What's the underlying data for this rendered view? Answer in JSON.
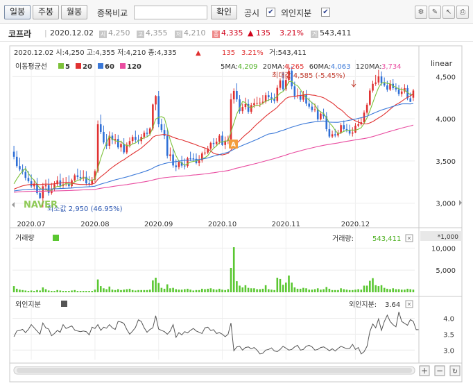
{
  "toolbar": {
    "tabs": [
      {
        "label": "일봉",
        "active": true
      },
      {
        "label": "주봉",
        "active": false
      },
      {
        "label": "월봉",
        "active": false
      }
    ],
    "compare_label": "종목비교",
    "compare_input_value": "",
    "confirm_label": "확인",
    "disclosure_label": "공시",
    "foreign_label": "외인지분",
    "check_mark": "✔",
    "icons": [
      "settings-icon",
      "pencil-icon",
      "cursor-icon",
      "print-icon"
    ]
  },
  "info": {
    "stock_name": "코프라",
    "date": "2020.12.02",
    "open_tag": "시",
    "open": "4,250",
    "high_tag": "고",
    "high": "4,355",
    "low_tag": "저",
    "low": "4,210",
    "close_tag": "종",
    "close": "4,335",
    "change": "▲ 135",
    "change_pct": "3.21%",
    "volume_tag": "거",
    "volume": "543,411"
  },
  "price_panel": {
    "header_text": "2020.12.02  시:4,250  고:4,355  저:4,210  종:4,335",
    "header_arrow": "▲",
    "header_change": "135",
    "header_pct": "3.21%",
    "header_volume": "거:543,411",
    "ma_title": "이동평균선",
    "ma_legend": [
      {
        "label": "5",
        "color": "#7cc139"
      },
      {
        "label": "20",
        "color": "#e03131"
      },
      {
        "label": "60",
        "color": "#3a78d8"
      },
      {
        "label": "120",
        "color": "#e94ca0"
      }
    ],
    "ma_values": [
      {
        "label": "5MA:",
        "value": "4,209",
        "color": "#4caf1f"
      },
      {
        "label": "20MA:",
        "value": "4,265",
        "color": "#e03131"
      },
      {
        "label": "60MA:",
        "value": "4,063",
        "color": "#3a78d8"
      },
      {
        "label": "120MA:",
        "value": "3,734",
        "color": "#e94ca0"
      }
    ],
    "scale_label": "linear",
    "max_label": "최대값 4,585 (-5.45%)",
    "min_label": "최소값 2,950 (46.95%)",
    "logo": "NAVER",
    "disclosure_marker": "A",
    "y_ticks": [
      "4,500",
      "4,000",
      "3,500",
      "3,000"
    ],
    "x_ticks": [
      "2020.07",
      "2020.08",
      "2020.09",
      "2020.10",
      "2020.11",
      "2020.12"
    ]
  },
  "volume_panel": {
    "title": "거래량",
    "current_label": "거래량:",
    "current_value": "543,411",
    "unit": "*1,000",
    "y_ticks": [
      "10,000",
      "5,000"
    ]
  },
  "foreign_panel": {
    "title": "외인지분",
    "current_label": "외인지분:",
    "current_value": "3.64",
    "y_ticks": [
      "4.0",
      "3.5",
      "3.0"
    ]
  },
  "colors": {
    "up": "#e03131",
    "down": "#2f6fd6",
    "volume": "#5ac731",
    "foreign_line": "#555555"
  },
  "chart_data": {
    "type": "candlestick",
    "x_range": [
      "2020-06-22",
      "2020-12-02"
    ],
    "price_ylim": [
      2800,
      4700
    ],
    "candles": {
      "open": [
        3610,
        3550,
        3440,
        3400,
        3370,
        3300,
        3260,
        3200,
        3230,
        3120,
        3060,
        3200,
        3215,
        3120,
        3165,
        3225,
        3270,
        3205,
        3224,
        3234,
        3202,
        3271,
        3330,
        3310,
        3294,
        3312,
        3235,
        3230,
        3279,
        3380,
        3935,
        3845,
        3720,
        3680,
        3800,
        3747,
        3761,
        3661,
        3702,
        3602,
        3692,
        3736,
        3785,
        3749,
        3735,
        3785,
        3835,
        3822,
        3885,
        4170,
        4270,
        3935,
        3868,
        3797,
        3560,
        3577,
        3447,
        3427,
        3489,
        3445,
        3440,
        3533,
        3531,
        3526,
        3475,
        3507,
        3590,
        3600,
        3647,
        3714,
        3702,
        3729,
        3800,
        3690,
        3740,
        3756,
        4230,
        4330,
        4230,
        4090,
        4140,
        4175,
        4084,
        4162,
        4186,
        4186,
        4191,
        4202,
        4279,
        4255,
        4233,
        4211,
        4367,
        4455,
        4350,
        4460,
        4570,
        4385,
        4270,
        4277,
        4226,
        4291,
        4180,
        4144,
        4103,
        4112,
        3993,
        4062,
        4030,
        3877,
        3790,
        3817,
        3802,
        3834,
        3925,
        3878,
        3868,
        3825,
        3837,
        3918,
        3935,
        3959,
        4073,
        4167,
        4334,
        4414,
        4430,
        4502,
        4422,
        4395,
        4346,
        4415,
        4364,
        4348,
        4294,
        4323,
        4363,
        4243,
        4250
      ],
      "high": [
        3680,
        3620,
        3540,
        3460,
        3440,
        3380,
        3340,
        3280,
        3300,
        3190,
        3240,
        3280,
        3290,
        3240,
        3260,
        3320,
        3350,
        3300,
        3310,
        3330,
        3290,
        3350,
        3410,
        3390,
        3390,
        3380,
        3320,
        3310,
        3400,
        3980,
        4050,
        3920,
        3820,
        3850,
        3840,
        3820,
        3810,
        3740,
        3770,
        3720,
        3780,
        3810,
        3860,
        3810,
        3820,
        3860,
        3890,
        3900,
        4180,
        4280,
        4330,
        4000,
        3940,
        3870,
        3660,
        3650,
        3520,
        3510,
        3560,
        3530,
        3550,
        3610,
        3590,
        3590,
        3570,
        3610,
        3660,
        3680,
        3730,
        3770,
        3770,
        3820,
        3850,
        3790,
        3800,
        4300,
        4360,
        4420,
        4280,
        4180,
        4250,
        4230,
        4190,
        4240,
        4260,
        4250,
        4280,
        4310,
        4330,
        4310,
        4300,
        4400,
        4480,
        4550,
        4520,
        4650,
        4620,
        4440,
        4360,
        4330,
        4330,
        4340,
        4250,
        4200,
        4180,
        4160,
        4080,
        4120,
        4080,
        3940,
        3860,
        3880,
        3870,
        3950,
        3980,
        3940,
        3930,
        3900,
        3950,
        3990,
        4010,
        4100,
        4190,
        4360,
        4450,
        4520,
        4580,
        4560,
        4490,
        4450,
        4460,
        4470,
        4420,
        4400,
        4370,
        4410,
        4400,
        4310,
        4355
      ],
      "low": [
        3520,
        3420,
        3380,
        3340,
        3270,
        3240,
        3180,
        3160,
        3100,
        3050,
        2950,
        3150,
        3090,
        3100,
        3140,
        3200,
        3180,
        3180,
        3200,
        3180,
        3180,
        3250,
        3280,
        3260,
        3260,
        3210,
        3190,
        3210,
        3250,
        3360,
        3820,
        3700,
        3640,
        3640,
        3700,
        3700,
        3640,
        3610,
        3580,
        3580,
        3660,
        3700,
        3720,
        3700,
        3700,
        3760,
        3790,
        3800,
        3860,
        4100,
        3900,
        3840,
        3760,
        3530,
        3500,
        3420,
        3380,
        3400,
        3420,
        3400,
        3420,
        3500,
        3490,
        3460,
        3440,
        3480,
        3570,
        3580,
        3630,
        3660,
        3680,
        3700,
        3680,
        3640,
        3700,
        3730,
        4180,
        4200,
        4060,
        4060,
        4110,
        4060,
        4060,
        4130,
        4150,
        4140,
        4170,
        4180,
        4210,
        4190,
        4180,
        4190,
        4340,
        4330,
        4330,
        4420,
        4350,
        4230,
        4240,
        4200,
        4200,
        4150,
        4120,
        4080,
        4080,
        3970,
        3980,
        4000,
        3850,
        3770,
        3770,
        3780,
        3780,
        3820,
        3850,
        3840,
        3800,
        3790,
        3830,
        3900,
        3920,
        3940,
        4050,
        4150,
        4310,
        4390,
        4400,
        4390,
        4380,
        4320,
        4330,
        4340,
        4320,
        4270,
        4260,
        4300,
        4220,
        4210,
        4210
      ],
      "close": [
        3550,
        3440,
        3400,
        3370,
        3300,
        3260,
        3200,
        3230,
        3120,
        3060,
        3200,
        3215,
        3120,
        3165,
        3225,
        3270,
        3205,
        3224,
        3234,
        3202,
        3271,
        3330,
        3310,
        3294,
        3312,
        3235,
        3230,
        3279,
        3380,
        3935,
        3845,
        3720,
        3680,
        3800,
        3747,
        3761,
        3661,
        3702,
        3602,
        3692,
        3736,
        3785,
        3749,
        3735,
        3785,
        3835,
        3822,
        3885,
        4170,
        4270,
        3935,
        3868,
        3797,
        3560,
        3577,
        3447,
        3427,
        3489,
        3445,
        3440,
        3533,
        3531,
        3526,
        3475,
        3507,
        3590,
        3600,
        3647,
        3714,
        3702,
        3729,
        3800,
        3690,
        3740,
        3756,
        4230,
        4330,
        4230,
        4090,
        4140,
        4175,
        4084,
        4162,
        4186,
        4186,
        4191,
        4202,
        4279,
        4255,
        4233,
        4211,
        4367,
        4455,
        4350,
        4460,
        4570,
        4385,
        4270,
        4277,
        4226,
        4291,
        4180,
        4144,
        4103,
        4112,
        3993,
        4062,
        4030,
        3877,
        3790,
        3817,
        3802,
        3834,
        3925,
        3878,
        3868,
        3825,
        3837,
        3918,
        3935,
        3959,
        4073,
        4167,
        4334,
        4414,
        4430,
        4502,
        4422,
        4395,
        4346,
        4415,
        4364,
        4348,
        4294,
        4323,
        4363,
        4243,
        4200,
        4335
      ]
    },
    "volume_ylim": [
      0,
      11000
    ],
    "volume": [
      1400,
      800,
      600,
      500,
      400,
      300,
      400,
      300,
      500,
      400,
      1100,
      700,
      400,
      300,
      300,
      500,
      400,
      300,
      300,
      300,
      400,
      500,
      300,
      300,
      300,
      300,
      300,
      300,
      600,
      2900,
      1400,
      900,
      700,
      1300,
      600,
      500,
      700,
      500,
      600,
      700,
      800,
      500,
      400,
      500,
      500,
      500,
      500,
      600,
      2700,
      3300,
      2100,
      1000,
      800,
      1800,
      900,
      1000,
      700,
      600,
      600,
      700,
      800,
      600,
      400,
      500,
      500,
      800,
      700,
      800,
      900,
      700,
      600,
      800,
      600,
      500,
      700,
      5500,
      10200,
      2500,
      1500,
      1100,
      1600,
      1000,
      900,
      900,
      700,
      700,
      800,
      1600,
      700,
      600,
      500,
      3300,
      3000,
      1700,
      2200,
      3800,
      2200,
      1100,
      800,
      800,
      1000,
      900,
      600,
      600,
      700,
      900,
      600,
      700,
      1200,
      800,
      500,
      500,
      500,
      900,
      700,
      600,
      500,
      500,
      600,
      700,
      600,
      1500,
      1500,
      2600,
      3200,
      1600,
      1400,
      1600,
      1000,
      800,
      700,
      900,
      700,
      700,
      600,
      600,
      800,
      700,
      600,
      543
    ],
    "foreign_ylim": [
      2.7,
      4.25
    ],
    "foreign": [
      3.42,
      3.6,
      3.62,
      3.65,
      3.55,
      3.65,
      3.8,
      3.7,
      3.6,
      3.5,
      3.85,
      3.7,
      3.66,
      3.45,
      3.52,
      3.62,
      3.56,
      3.8,
      3.68,
      3.72,
      3.76,
      3.63,
      3.6,
      3.58,
      3.6,
      3.58,
      3.48,
      3.72,
      3.68,
      3.8,
      3.62,
      3.72,
      3.69,
      3.8,
      3.7,
      3.65,
      3.9,
      3.88,
      3.84,
      3.65,
      3.5,
      3.6,
      3.71,
      3.95,
      3.9,
      3.7,
      3.56,
      3.65,
      3.7,
      4.08,
      3.66,
      3.62,
      3.58,
      3.5,
      3.6,
      3.8,
      3.4,
      3.55,
      3.48,
      3.58,
      3.54,
      3.62,
      3.68,
      3.6,
      3.56,
      3.52,
      3.7,
      3.72,
      3.62,
      3.64,
      3.52,
      3.55,
      3.5,
      3.42,
      3.5,
      3.85,
      2.98,
      3.1,
      3.12,
      3.0,
      3.08,
      3.1,
      3.04,
      3.08,
      3.0,
      2.88,
      2.9,
      3.0,
      3.02,
      3.07,
      2.97,
      2.95,
      3.02,
      3.12,
      3.06,
      3.0,
      3.02,
      3.1,
      3.15,
      3.0,
      3.02,
      3.12,
      3.15,
      3.1,
      3.0,
      3.02,
      3.08,
      3.1,
      3.05,
      2.98,
      3.04,
      2.97,
      3.05,
      3.12,
      3.08,
      3.04,
      3.05,
      3.18,
      3.02,
      3.08,
      2.88,
      2.95,
      3.12,
      3.58,
      3.82,
      3.7,
      3.98,
      3.62,
      3.9,
      4.1,
      3.9,
      3.8,
      3.73,
      4.2,
      3.9,
      3.84,
      3.78,
      3.96,
      3.9,
      3.64,
      3.64
    ]
  }
}
